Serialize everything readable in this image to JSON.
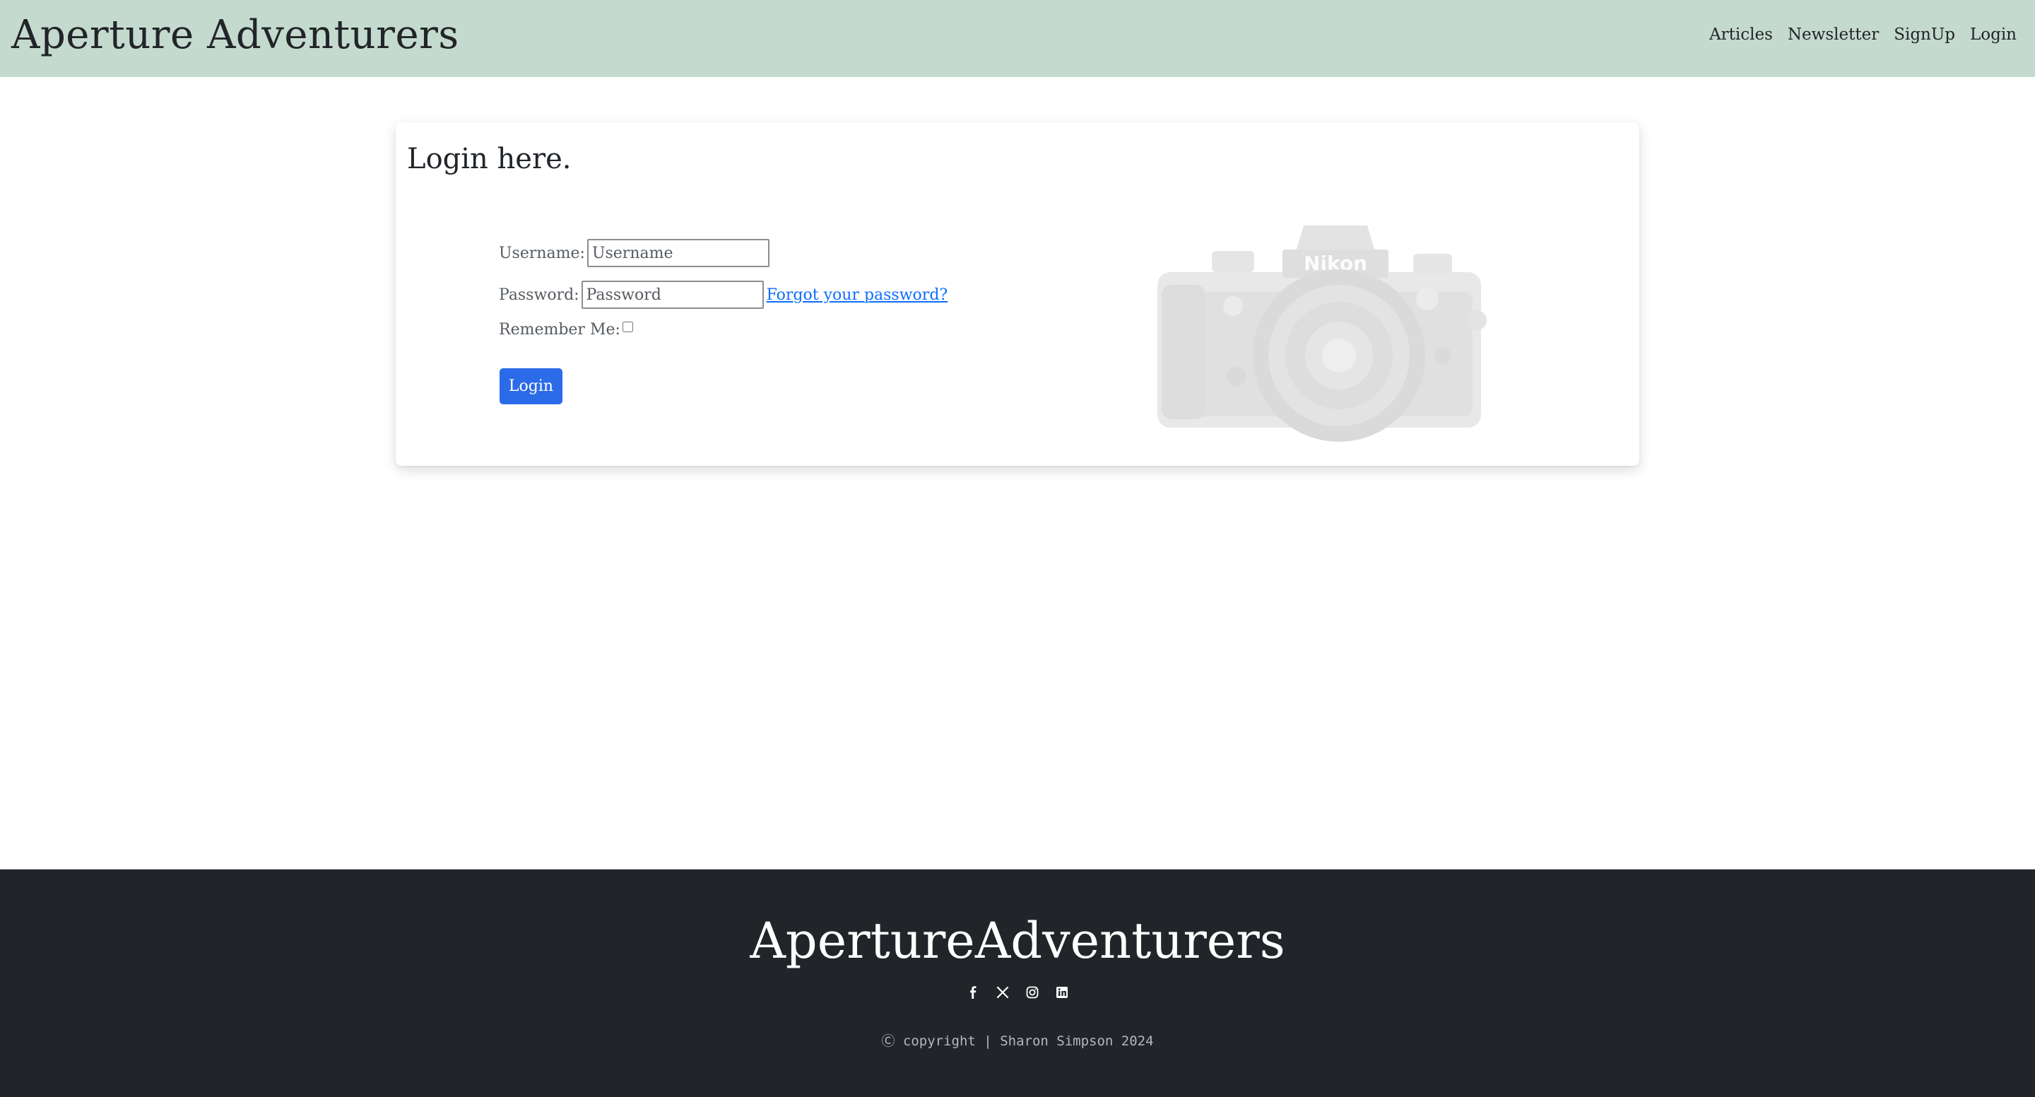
{
  "header": {
    "brand": "Aperture Adventurers",
    "nav": [
      "Articles",
      "Newsletter",
      "SignUp",
      "Login"
    ]
  },
  "login_card": {
    "title": "Login here.",
    "username_label": "Username:",
    "username_placeholder": "Username",
    "password_label": "Password:",
    "password_placeholder": "Password",
    "forgot_link": "Forgot your password?",
    "remember_label": "Remember Me:",
    "submit_label": "Login",
    "image_brand_text": "Nikon"
  },
  "footer": {
    "brand": "ApertureAdventurers",
    "socials": [
      "facebook-icon",
      "x-icon",
      "instagram-icon",
      "linkedin-icon"
    ],
    "copyright_symbol": "Ⓒ",
    "copyright_text": "copyright | Sharon Simpson 2024"
  },
  "colors": {
    "header_bg": "#c5dace",
    "footer_bg": "#212529",
    "button_bg": "#2c6be8",
    "link": "#0d6efd"
  }
}
